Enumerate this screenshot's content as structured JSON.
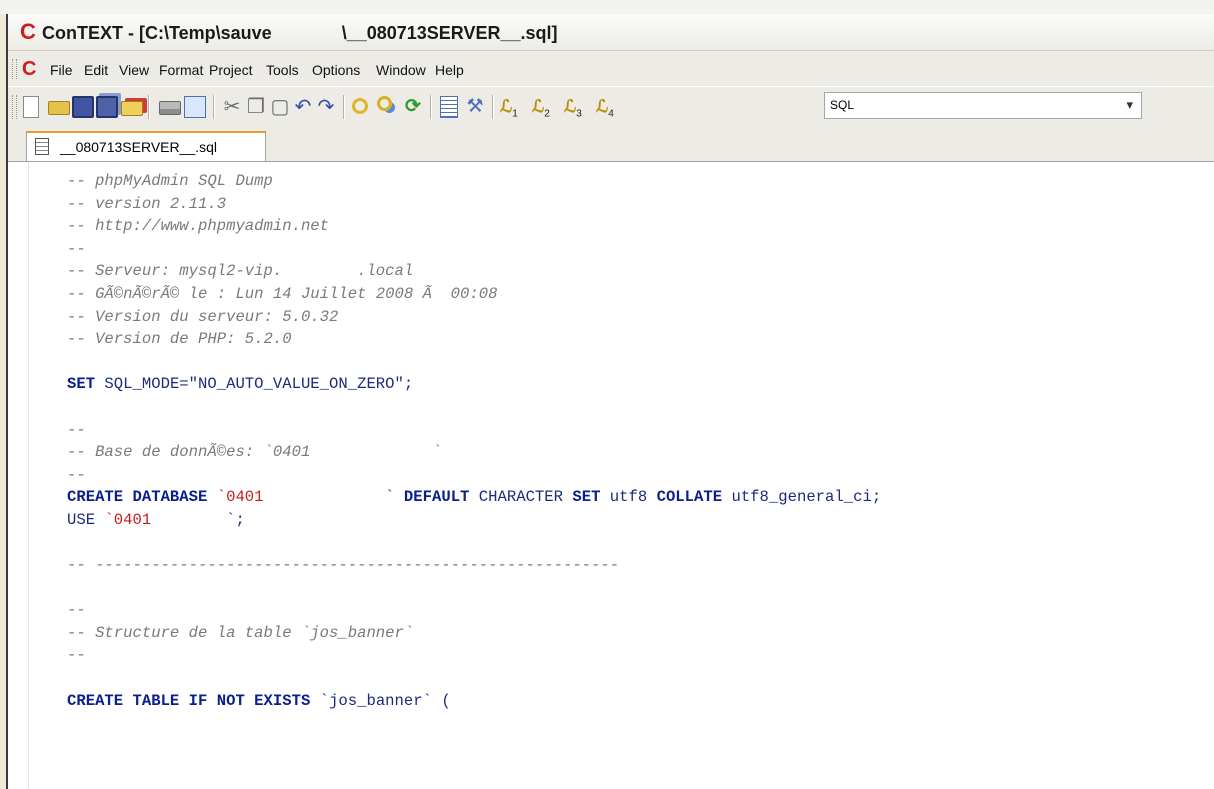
{
  "window": {
    "title": "ConTEXT - [C:\\Temp\\sauve              \\__080713SERVER__.sql]"
  },
  "menu": [
    "File",
    "Edit",
    "View",
    "Format",
    "Project",
    "Tools",
    "Options",
    "Window",
    "Help"
  ],
  "toolbar": {
    "highlighter_value": "SQL"
  },
  "tab": {
    "label": "__080713SERVER__.sql"
  },
  "editor": {
    "lines": [
      [
        {
          "t": "comment",
          "v": "-- phpMyAdmin SQL Dump"
        }
      ],
      [
        {
          "t": "comment",
          "v": "-- version 2.11.3"
        }
      ],
      [
        {
          "t": "comment",
          "v": "-- http://www.phpmyadmin.net"
        }
      ],
      [
        {
          "t": "comment",
          "v": "--"
        }
      ],
      [
        {
          "t": "comment",
          "v": "-- Serveur: mysql2-vip.        .local"
        }
      ],
      [
        {
          "t": "comment",
          "v": "-- GÃ©nÃ©rÃ© le : Lun 14 Juillet 2008 Ã  00:08"
        }
      ],
      [
        {
          "t": "comment",
          "v": "-- Version du serveur: 5.0.32"
        }
      ],
      [
        {
          "t": "comment",
          "v": "-- Version de PHP: 5.2.0"
        }
      ],
      [],
      [
        {
          "t": "kw",
          "v": "SET"
        },
        {
          "t": "plain",
          "v": " SQL_MODE=\"NO_AUTO_VALUE_ON_ZERO\";"
        }
      ],
      [],
      [
        {
          "t": "comment",
          "v": "--"
        }
      ],
      [
        {
          "t": "comment",
          "v": "-- Base de donnÃ©es: `0401             `"
        }
      ],
      [
        {
          "t": "comment",
          "v": "--"
        }
      ],
      [
        {
          "t": "kw",
          "v": "CREATE DATABASE"
        },
        {
          "t": "plain",
          "v": " "
        },
        {
          "t": "str",
          "v": "`0401"
        },
        {
          "t": "plain",
          "v": "             ` "
        },
        {
          "t": "kw",
          "v": "DEFAULT"
        },
        {
          "t": "plain",
          "v": " CHARACTER "
        },
        {
          "t": "kw",
          "v": "SET"
        },
        {
          "t": "plain",
          "v": " utf8 "
        },
        {
          "t": "kw",
          "v": "COLLATE"
        },
        {
          "t": "plain",
          "v": " utf8_general_ci;"
        }
      ],
      [
        {
          "t": "plain",
          "v": "USE "
        },
        {
          "t": "str",
          "v": "`0401"
        },
        {
          "t": "plain",
          "v": "        `;"
        }
      ],
      [],
      [
        {
          "t": "comment",
          "v": "-- --------------------------------------------------------"
        }
      ],
      [],
      [
        {
          "t": "comment",
          "v": "--"
        }
      ],
      [
        {
          "t": "comment",
          "v": "-- Structure de la table `jos_banner`"
        }
      ],
      [
        {
          "t": "comment",
          "v": "--"
        }
      ],
      [],
      [
        {
          "t": "kw",
          "v": "CREATE TABLE IF NOT EXISTS"
        },
        {
          "t": "plain",
          "v": " `jos_banner` ("
        }
      ]
    ]
  }
}
